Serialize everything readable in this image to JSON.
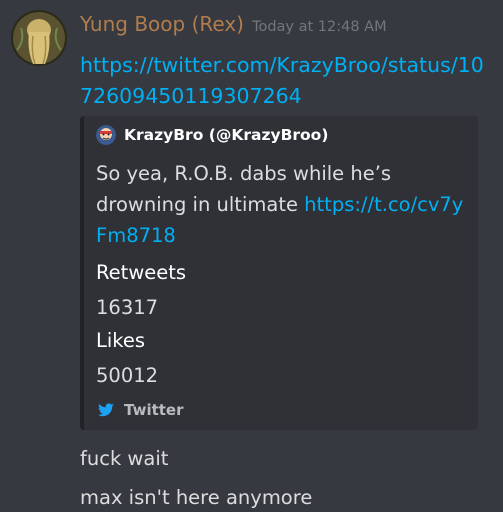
{
  "message": {
    "username": "Yung Boop (Rex)",
    "timestamp": "Today at 12:48 AM",
    "link_text": "https://twitter.com/KrazyBroo/status/1072609450119307264",
    "avatar_icon": "avatar-icon",
    "username_color": "#b27d4e"
  },
  "embed": {
    "author": "KrazyBro (@KrazyBroo)",
    "author_icon": "avatar-icon",
    "description": "So yea, R.O.B. dabs while he’s drowning in ultimate ",
    "description_link": "https://t.co/cv7yFm8718",
    "fields": [
      {
        "name": "Retweets",
        "value": "16317"
      },
      {
        "name": "Likes",
        "value": "50012"
      }
    ],
    "footer_icon": "twitter-bird-icon",
    "footer_text": "Twitter"
  },
  "followups": [
    "fuck wait",
    "max isn't here anymore"
  ],
  "colors": {
    "background": "#36393f",
    "embed_background": "#2f3136",
    "link": "#00b0f4",
    "twitter_blue": "#1da1f2"
  }
}
